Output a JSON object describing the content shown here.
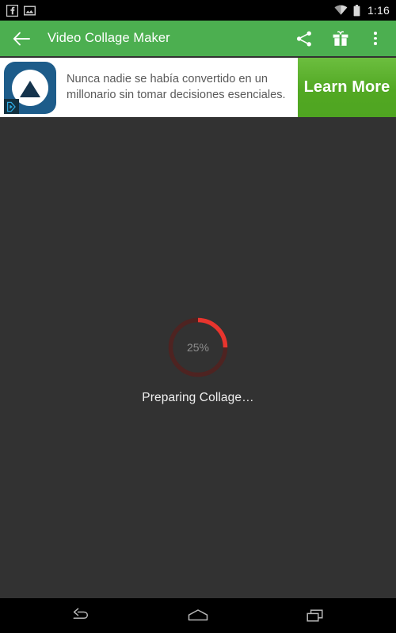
{
  "status_bar": {
    "notification_icons": [
      "facebook-icon",
      "screenshot-icon"
    ],
    "wifi_icon": "wifi-icon",
    "battery_icon": "battery-icon",
    "time": "1:16"
  },
  "app_bar": {
    "back_label": "back-arrow-icon",
    "title": "Video Collage Maker",
    "actions": [
      {
        "name": "share-icon",
        "label": "Share"
      },
      {
        "name": "gift-icon",
        "label": "Gift"
      },
      {
        "name": "overflow-menu-icon",
        "label": "More options"
      }
    ]
  },
  "ad": {
    "icon_name": "ad-app-icon",
    "adchoices_name": "adchoices-icon",
    "text": "Nunca nadie se había convertido en un millonario sin tomar decisiones esenciales.",
    "cta_label": "Learn More"
  },
  "progress": {
    "percent_text": "25%",
    "percent_value": 25,
    "caption": "Preparing Collage…",
    "arc_color": "#e8352e",
    "track_color": "#4e2321"
  },
  "nav_bar": {
    "buttons": [
      {
        "name": "nav-back-button",
        "label": "Back"
      },
      {
        "name": "nav-home-button",
        "label": "Home"
      },
      {
        "name": "nav-recents-button",
        "label": "Recents"
      }
    ]
  },
  "colors": {
    "app_bar_green": "#4caf50",
    "cta_green": "#52a823",
    "content_bg": "#323232"
  }
}
